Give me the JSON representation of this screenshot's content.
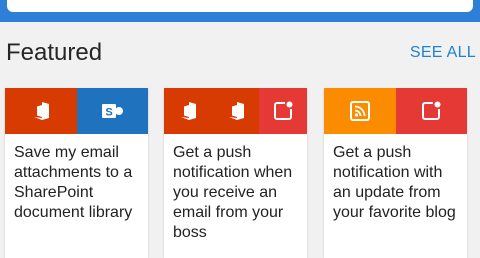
{
  "featured": {
    "title": "Featured",
    "see_all": "SEE ALL"
  },
  "colors": {
    "office_red": "#d83b01",
    "sharepoint_blue": "#1f72bd",
    "notification_red": "#e53935",
    "rss_orange": "#fb8c00",
    "link_blue": "#1e82d2"
  },
  "cards": [
    {
      "services": [
        "office-icon",
        "sharepoint-icon"
      ],
      "text": "Save my email attachments to a SharePoint document library"
    },
    {
      "services": [
        "office-icon",
        "office-icon",
        "notification-icon"
      ],
      "text": "Get a push notification when you receive an email from your boss"
    },
    {
      "services": [
        "rss-icon",
        "notification-icon"
      ],
      "text": "Get a push notification with an update from your favorite blog"
    }
  ]
}
